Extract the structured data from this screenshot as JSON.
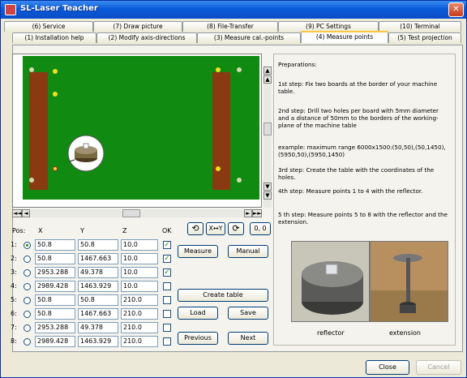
{
  "window": {
    "title": "SL-Laser Teacher",
    "close_symbol": "✕"
  },
  "tabs": {
    "row1": [
      {
        "label": "(6) Service"
      },
      {
        "label": "(7) Draw picture"
      },
      {
        "label": "(8) File-Transfer"
      },
      {
        "label": "(9) PC Settings"
      },
      {
        "label": "(10) Terminal"
      }
    ],
    "row2": [
      {
        "label": "(1) Installation help"
      },
      {
        "label": "(2) Modify axis-directions"
      },
      {
        "label": "(3) Measure cal.-points"
      },
      {
        "label": "(4) Measure points"
      },
      {
        "label": "(5) Test projection"
      }
    ],
    "active": "(4) Measure points"
  },
  "table": {
    "headers": {
      "pos": "Pos:",
      "x": "X",
      "y": "Y",
      "z": "Z",
      "ok": "OK"
    },
    "rows": [
      {
        "label": "1:",
        "x": "50.8",
        "y": "50.8",
        "z": "10.0",
        "ok": true,
        "selected": true
      },
      {
        "label": "2:",
        "x": "50.8",
        "y": "1467.663",
        "z": "10.0",
        "ok": true,
        "selected": false
      },
      {
        "label": "3:",
        "x": "2953.288",
        "y": "49.378",
        "z": "10.0",
        "ok": true,
        "selected": false
      },
      {
        "label": "4:",
        "x": "2989.428",
        "y": "1463.929",
        "z": "10.0",
        "ok": false,
        "selected": false
      },
      {
        "label": "5:",
        "x": "50.8",
        "y": "50.8",
        "z": "210.0",
        "ok": false,
        "selected": false
      },
      {
        "label": "6:",
        "x": "50.8",
        "y": "1467.663",
        "z": "210.0",
        "ok": false,
        "selected": false
      },
      {
        "label": "7:",
        "x": "2953.288",
        "y": "49.378",
        "z": "210.0",
        "ok": false,
        "selected": false
      },
      {
        "label": "8:",
        "x": "2989.428",
        "y": "1463.929",
        "z": "210.0",
        "ok": false,
        "selected": false
      }
    ]
  },
  "tools": {
    "rotate_left": "⟲",
    "swap_xy": "X↔Y",
    "rotate_right": "⟳",
    "origin": "0, 0"
  },
  "buttons": {
    "measure": "Measure",
    "manual": "Manual",
    "create_table": "Create table",
    "load": "Load",
    "save": "Save",
    "previous": "Previous",
    "next": "Next",
    "close": "Close",
    "cancel": "Cancel"
  },
  "scroll": {
    "first": "◄◄",
    "prev": "◄",
    "next": "►",
    "last": "►►",
    "up_fast": "▲",
    "down_fast": "▼"
  },
  "instructions": {
    "heading": "Preparations:",
    "step1": "1st step: Fix two boards at the border of your machine table.",
    "step2": "2nd step: Drill two holes per board with 5mm diameter and a distance of 50mm to the borders of the working-plane of the machine table",
    "example": "example: maximum range 6000x1500:(50,50),(50,1450),(5950,50),(5950,1450)",
    "step3": "3rd step: Create the table with the coordinates of the holes.",
    "step4": "4th step: Measure points 1 to 4 with the reflector.",
    "step5": "5 th step: Measure points 5 to 8 with the reflector and the extension."
  },
  "photos": {
    "reflector_caption": "reflector",
    "extension_caption": "extension"
  },
  "colors": {
    "board_green": "#108a10",
    "wood_brown": "#8a3a10",
    "hole_yellow": "#f0e020",
    "hole_unmeasured": "#d8d8b0",
    "active_tab_highlight": "#ffc83c"
  }
}
